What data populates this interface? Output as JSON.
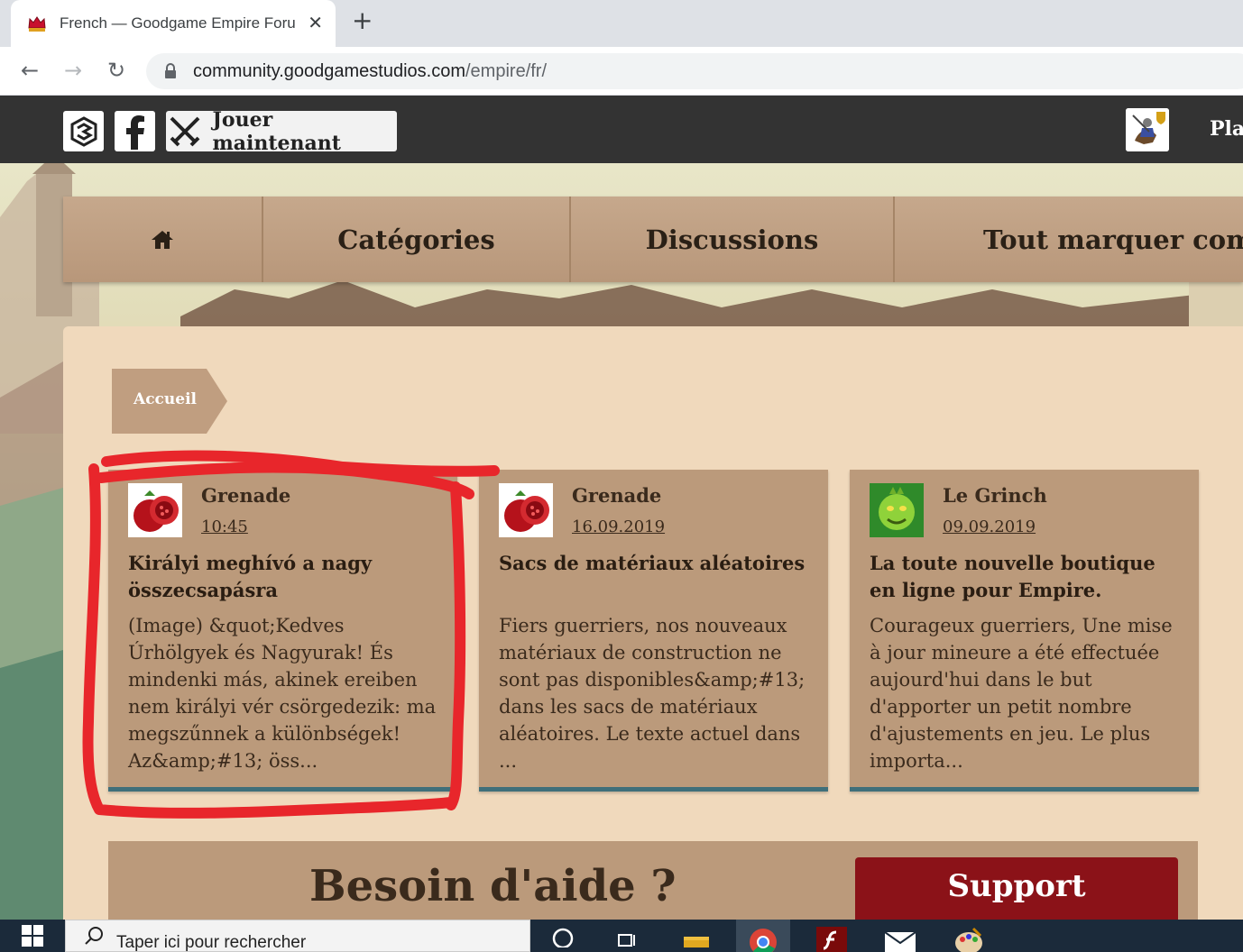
{
  "browser": {
    "tab_title": "French — Goodgame Empire Forum",
    "tab_close": "✕",
    "new_tab": "+",
    "url_host": "community.goodgamestudios.com",
    "url_path": "/empire/fr/"
  },
  "site_header": {
    "play_label": "Jouer maintenant",
    "username": "Plai"
  },
  "nav": {
    "items": [
      "Catégories",
      "Discussions",
      "Tout marquer comme lu"
    ]
  },
  "breadcrumb": {
    "home": "Accueil"
  },
  "cards": [
    {
      "author": "Grenade",
      "date": "10:45",
      "title": "Királyi meghívó a nagy összecsapásra",
      "excerpt": "(Image) &quot;Kedves Úrhölgyek és Nagyurak! És mindenki más, akinek ereiben nem királyi vér csörgedezik: ma megszűnnek a különbségek! Az&amp;#13; öss..."
    },
    {
      "author": "Grenade",
      "date": "16.09.2019",
      "title": "Sacs de matériaux aléatoires",
      "excerpt": "Fiers guerriers, nos nouveaux matériaux de construction ne sont pas disponibles&amp;#13; dans les sacs de matériaux aléatoires. Le texte actuel dans ..."
    },
    {
      "author": "Le Grinch",
      "date": "09.09.2019",
      "title": "La toute nouvelle boutique en ligne pour Empire.",
      "excerpt": "Courageux guerriers, Une mise à jour mineure a été effectuée aujourd'hui dans le but d'apporter un petit nombre d'ajustements en jeu. Le plus importa..."
    }
  ],
  "help": {
    "title": "Besoin d'aide ?",
    "support_label": "Support"
  },
  "taskbar": {
    "search_placeholder": "Taper ici pour rechercher"
  },
  "colors": {
    "accent_card": "#bb9a7b",
    "card_border": "#3f6f7a",
    "support_button": "#8b1218",
    "annotation": "#e8262b"
  }
}
